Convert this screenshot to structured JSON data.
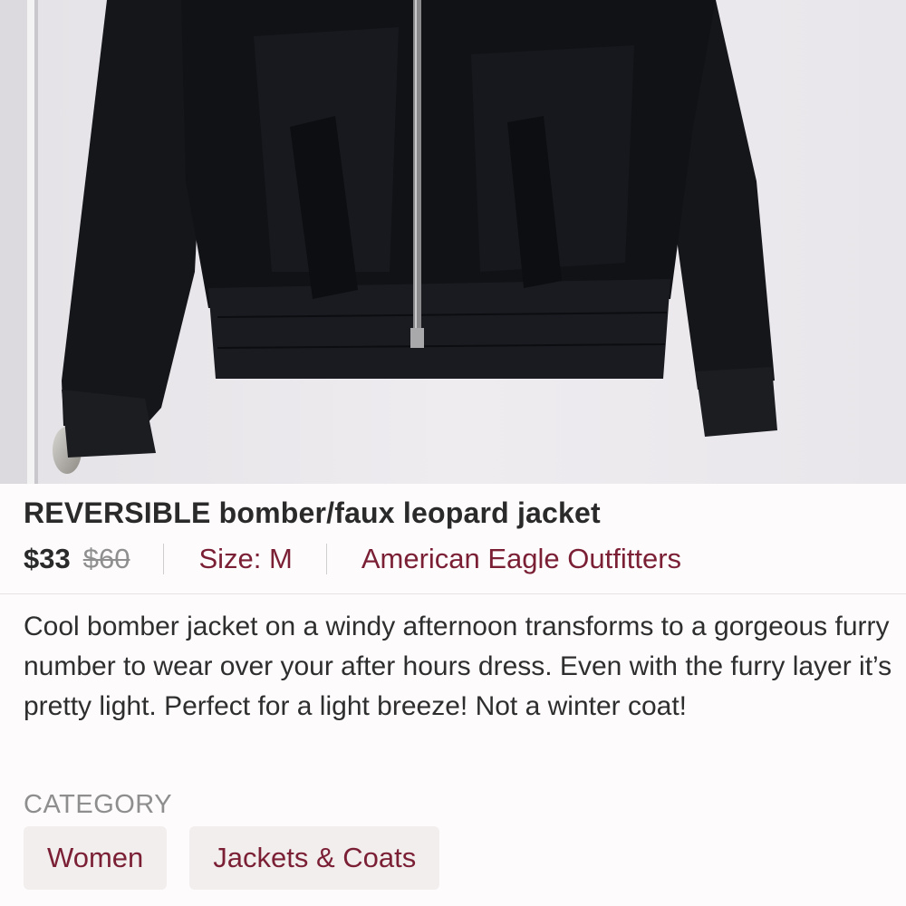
{
  "listing": {
    "title": "REVERSIBLE bomber/faux leopard jacket",
    "price": "$33",
    "original_price": "$60",
    "size": "Size: M",
    "brand": "American Eagle Outfitters",
    "description": "Cool bomber jacket on a windy afternoon transforms to a gorgeous furry number to wear over your after hours dress. Even with the furry layer it’s pretty light. Perfect for a light breeze! Not a winter coat!"
  },
  "category": {
    "heading": "CATEGORY",
    "chips": [
      {
        "label": "Women"
      },
      {
        "label": "Jackets & Coats"
      }
    ]
  },
  "colors": {
    "accent": "#7b1f35",
    "text": "#2a2a2a",
    "muted": "#8e8e8e",
    "chip_bg": "#f2eeee"
  }
}
